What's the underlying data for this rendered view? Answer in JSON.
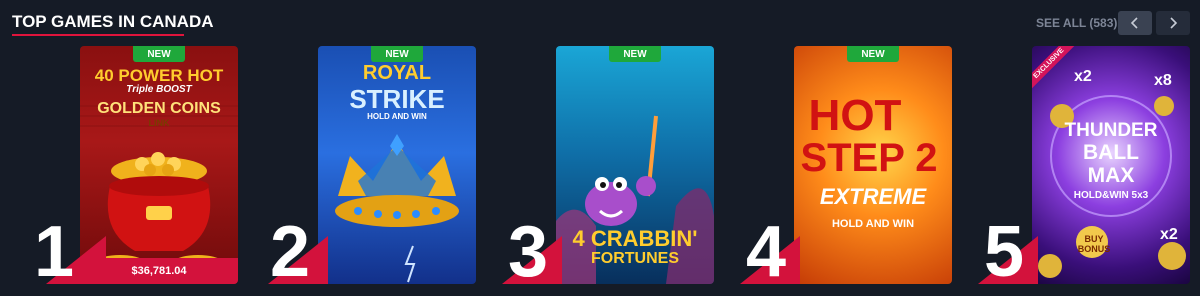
{
  "header": {
    "title": "TOP GAMES IN CANADA",
    "see_all": "SEE ALL (583)"
  },
  "colors": {
    "accent": "#e0143c",
    "new_badge": "#1fa83b",
    "background": "#151b26"
  },
  "games": [
    {
      "rank": "1",
      "badge": "NEW",
      "title_line1": "40 POWER HOT",
      "title_line2": "Triple BOOST",
      "title_line3": "GOLDEN COINS",
      "title_line4": "LINK",
      "jackpot": "$36,781.04"
    },
    {
      "rank": "2",
      "badge": "NEW",
      "title_line1": "ROYAL",
      "title_line2": "STRIKE",
      "title_line3": "HOLD AND WIN"
    },
    {
      "rank": "3",
      "badge": "NEW",
      "title_line1": "4 CRABBIN'",
      "title_line2": "FORTUNES"
    },
    {
      "rank": "4",
      "badge": "NEW",
      "title_line1": "HOT",
      "title_line2": "STEP 2",
      "title_line3": "EXTREME",
      "title_line4": "HOLD AND WIN"
    },
    {
      "rank": "5",
      "ribbon": "EXCLUSIVE",
      "title_line1": "THUNDER",
      "title_line2": "BALL",
      "title_line3": "MAX",
      "title_line4": "HOLD&WIN 5x3",
      "buy_bonus": "BUY BONUS",
      "mult_a": "x2",
      "mult_b": "x8",
      "mult_c": "x2"
    }
  ]
}
